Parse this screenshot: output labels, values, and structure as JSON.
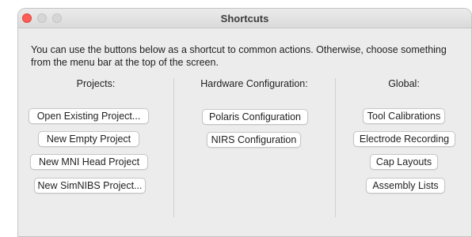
{
  "window": {
    "title": "Shortcuts"
  },
  "description": "You can use the buttons below as a shortcut to common actions. Otherwise, choose something from the menu bar at the top of the screen.",
  "projects": {
    "header": "Projects:",
    "buttons": [
      "Open Existing Project...",
      "New Empty Project",
      "New MNI Head Project",
      "New SimNIBS Project..."
    ]
  },
  "hardware": {
    "header": "Hardware Configuration:",
    "buttons": [
      "Polaris Configuration",
      "NIRS Configuration"
    ]
  },
  "global": {
    "header": "Global:",
    "buttons": [
      "Tool Calibrations",
      "Electrode Recording",
      "Cap Layouts",
      "Assembly Lists"
    ]
  },
  "colors": {
    "close_button": "#ff5f57",
    "inactive_button": "#d6d6d6",
    "window_background": "#ececec"
  }
}
